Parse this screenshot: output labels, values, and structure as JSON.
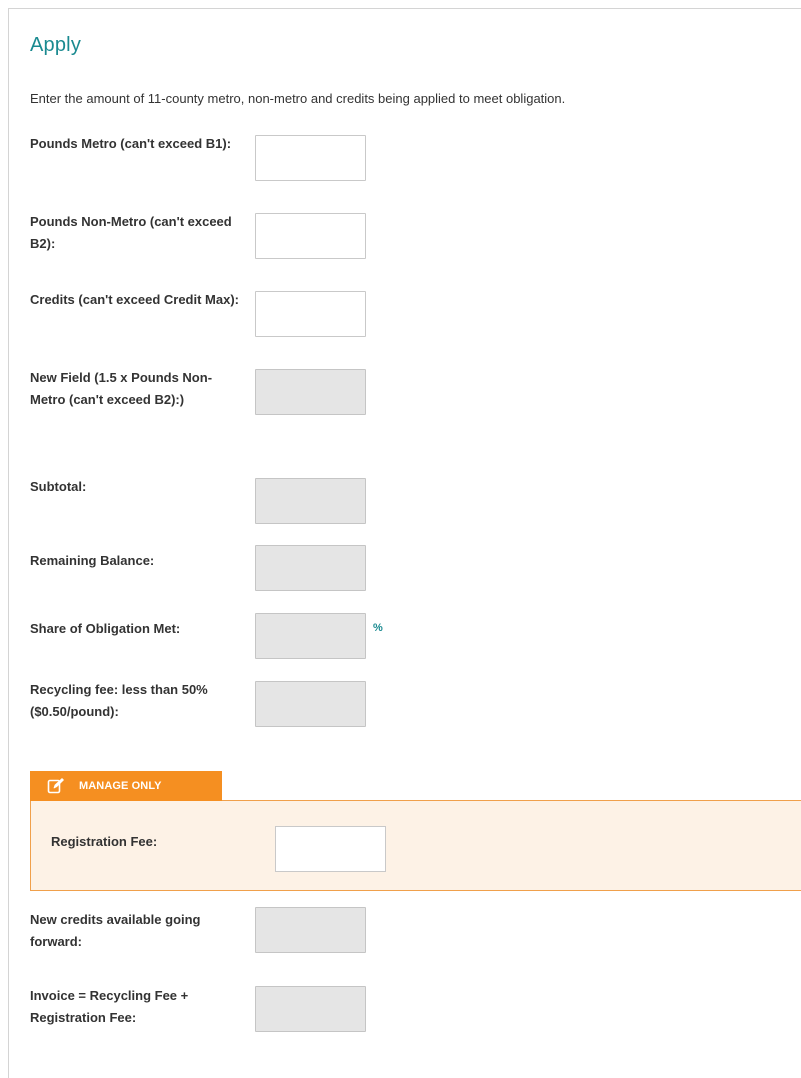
{
  "section": {
    "title": "Apply",
    "intro": "Enter the amount of 11-county metro, non-metro and credits being applied to meet obligation."
  },
  "fields": {
    "pounds_metro": {
      "label": "Pounds Metro (can't exceed B1):",
      "value": ""
    },
    "pounds_non_metro": {
      "label": "Pounds Non-Metro (can't exceed B2):",
      "value": ""
    },
    "credits": {
      "label": "Credits (can't exceed Credit Max):",
      "value": ""
    },
    "new_field": {
      "label": "New Field (1.5 x Pounds Non-Metro (can't exceed B2):)",
      "value": ""
    },
    "subtotal": {
      "label": "Subtotal:",
      "value": ""
    },
    "remaining_balance": {
      "label": "Remaining Balance:",
      "value": ""
    },
    "share_of_obligation": {
      "label": "Share of Obligation Met:",
      "value": "",
      "unit": "%"
    },
    "recycling_fee": {
      "label": "Recycling fee: less than 50% ($0.50/pound):",
      "value": ""
    },
    "new_credits": {
      "label": "New credits available going forward:",
      "value": ""
    },
    "invoice": {
      "label": "Invoice = Recycling Fee + Registration Fee:",
      "value": ""
    }
  },
  "manage_only": {
    "tab_label": "MANAGE ONLY",
    "tab_icon": "edit-icon",
    "registration_fee": {
      "label": "Registration Fee:",
      "value": ""
    }
  },
  "colors": {
    "accent_teal": "#1a8a90",
    "manage_orange": "#f58f21",
    "manage_panel_bg": "#fdf2e6",
    "readonly_bg": "#e5e5e5"
  }
}
